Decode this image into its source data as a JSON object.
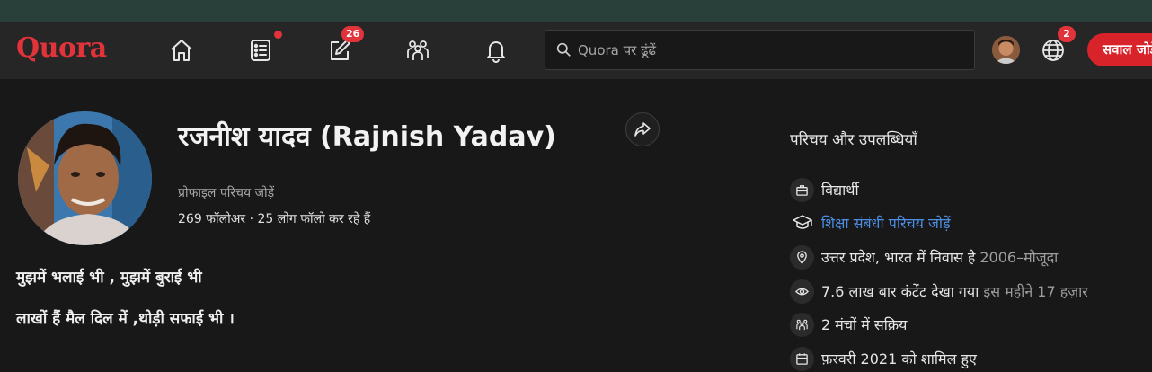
{
  "header": {
    "logo": "Quora",
    "search_placeholder": "Quora पर ढूंढें",
    "answer_badge": "26",
    "languages_badge": "2",
    "ask_button": "सवाल जोड़ें",
    "icons": [
      "home-icon",
      "following-icon",
      "answer-icon",
      "spaces-icon",
      "notifications-icon",
      "search-icon",
      "globe-icon"
    ],
    "colors": {
      "brand": "#e0333a",
      "button": "#d8232a",
      "link": "#4d8fe6"
    }
  },
  "profile": {
    "name": "रजनीश यादव (Rajnish Yadav)",
    "add_bio": "प्रोफाइल परिचय जोड़ें",
    "follow_stats": "269 फॉलोअर · 25 लोग फॉलो कर रहे हैं",
    "bio": [
      "मुझमें भलाई भी , मुझमें बुराई भी",
      "लाखों हैं मैल दिल में ,थोड़ी सफाई भी ।"
    ]
  },
  "sidebar": {
    "title": "परिचय और उपलब्धियाँ",
    "credentials": [
      {
        "icon": "briefcase-icon",
        "text": "विद्यार्थी",
        "extra": ""
      },
      {
        "icon": "graduation-cap-icon",
        "text": "शिक्षा संबंधी परिचय जोड़ें",
        "extra": ""
      },
      {
        "icon": "location-icon",
        "text": "उत्तर प्रदेश, भारत में निवास है",
        "extra": "2006–मौजूदा"
      },
      {
        "icon": "eye-icon",
        "text": "7.6 लाख बार कंटेंट देखा गया",
        "extra": "इस महीने 17 हज़ार"
      },
      {
        "icon": "spaces-icon",
        "text": "2 मंचों में सक्रिय",
        "extra": ""
      },
      {
        "icon": "calendar-icon",
        "text": "फ़रवरी 2021 को शामिल हुए",
        "extra": ""
      }
    ]
  }
}
